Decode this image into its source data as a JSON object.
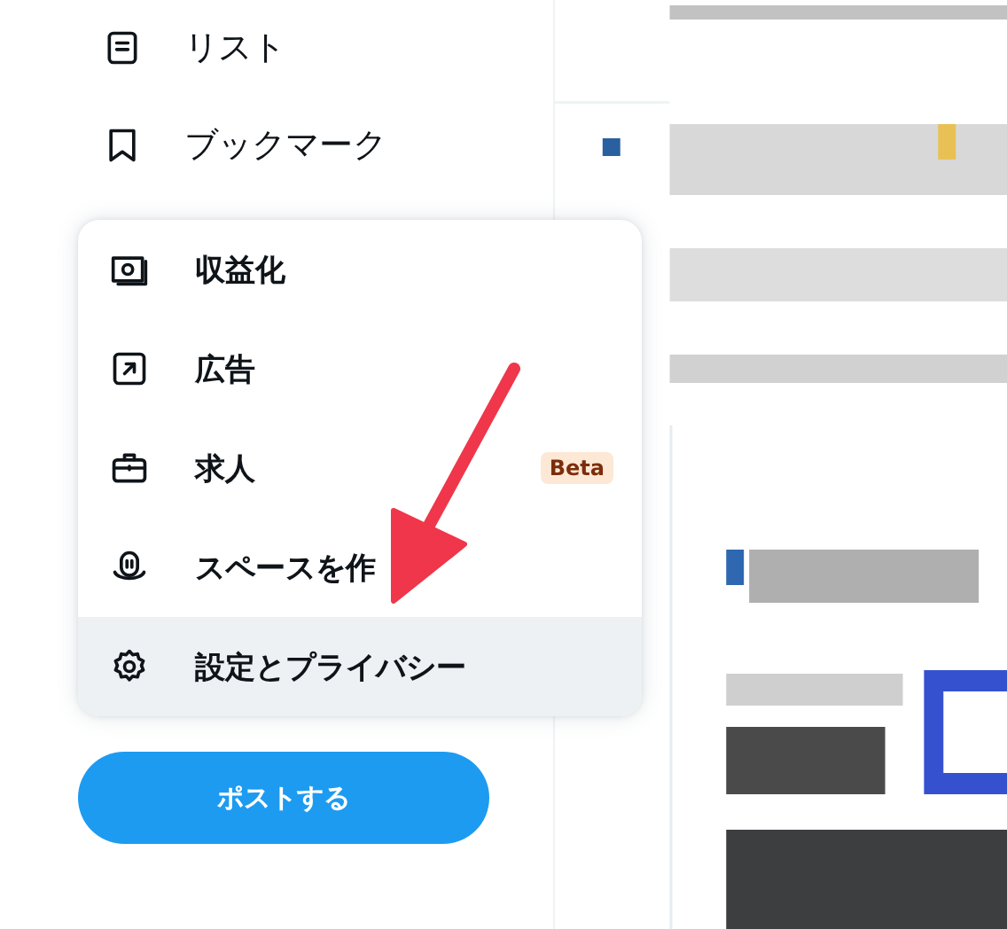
{
  "sidebar": {
    "items": [
      {
        "label": "リスト"
      },
      {
        "label": "ブックマーク"
      }
    ]
  },
  "more_menu": {
    "items": [
      {
        "label": "収益化",
        "highlighted": false
      },
      {
        "label": "広告",
        "highlighted": false
      },
      {
        "label": "求人",
        "badge": "Beta",
        "highlighted": false
      },
      {
        "label": "スペースを作",
        "highlighted": false
      },
      {
        "label": "設定とプライバシー",
        "highlighted": true
      }
    ]
  },
  "post_button": {
    "label": "ポストする"
  },
  "annotations": [
    {
      "kind": "arrow"
    }
  ]
}
